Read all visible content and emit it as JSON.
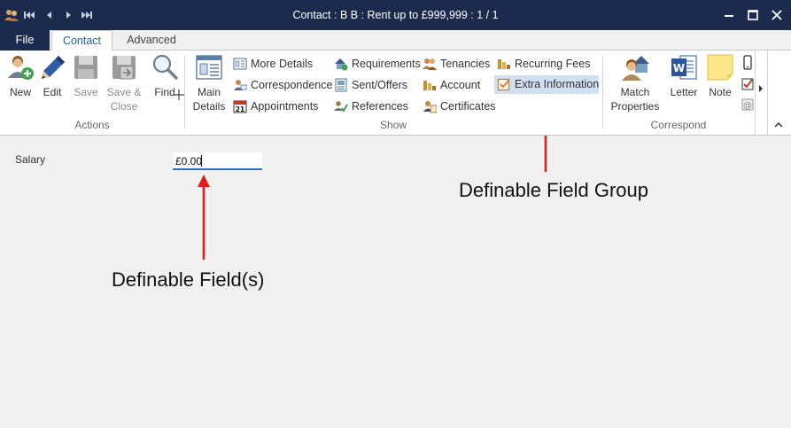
{
  "window": {
    "title": "Contact : B B : Rent up to £999,999 : 1 / 1"
  },
  "tabs": {
    "file": "File",
    "contact": "Contact",
    "advanced": "Advanced"
  },
  "ribbon": {
    "actions": {
      "group_label": "Actions",
      "new": "New",
      "edit": "Edit",
      "save": "Save",
      "save_close_line1": "Save &",
      "save_close_line2": "Close",
      "find": "Find"
    },
    "show": {
      "group_label": "Show",
      "main_details_line1": "Main",
      "main_details_line2": "Details",
      "more_details": "More Details",
      "correspondence": "Correspondence",
      "appointments": "Appointments",
      "requirements": "Requirements",
      "sent_offers": "Sent/Offers",
      "references": "References",
      "tenancies": "Tenancies",
      "account": "Account",
      "certificates": "Certificates",
      "recurring_fees": "Recurring Fees",
      "extra_information": "Extra Information"
    },
    "correspond": {
      "group_label": "Correspond",
      "match_properties_line1": "Match",
      "match_properties_line2": "Properties",
      "letter": "Letter",
      "note": "Note"
    }
  },
  "content": {
    "salary_label": "Salary",
    "salary_value": "£0.00"
  },
  "annotations": {
    "field_group": "Definable Field Group",
    "fields": "Definable Field(s)"
  },
  "colors": {
    "titlebar": "#1b2b4d",
    "accent": "#2a6fc4",
    "arrow": "#e41e1e",
    "selected": "#cfe0f5"
  }
}
